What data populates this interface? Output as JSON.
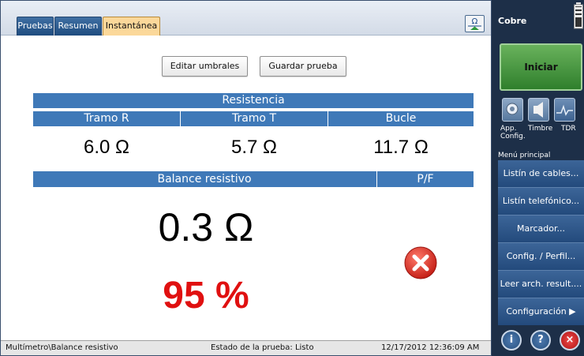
{
  "tabs": [
    {
      "label": "Pruebas",
      "active": false
    },
    {
      "label": "Resumen",
      "active": false
    },
    {
      "label": "Instantánea",
      "active": true
    }
  ],
  "toolbar": {
    "edit_thresholds": "Editar umbrales",
    "save_test": "Guardar prueba"
  },
  "resistance": {
    "title": "Resistencia",
    "columns": [
      "Tramo R",
      "Tramo T",
      "Bucle"
    ],
    "values": [
      "6.0 Ω",
      "5.7 Ω",
      "11.7 Ω"
    ]
  },
  "balance": {
    "title": "Balance resistivo",
    "pf_label": "P/F",
    "value": "0.3 Ω",
    "percent": "95 %",
    "result": "fail"
  },
  "status": {
    "path": "Multímetro\\Balance resistivo",
    "state": "Estado de la prueba: Listo",
    "datetime": "12/17/2012 12:36:09 AM"
  },
  "sidebar": {
    "title": "Cobre",
    "start_label": "Iniciar",
    "tools": [
      {
        "label": "App.\nConfig.",
        "icon": "wrench-icon"
      },
      {
        "label": "Timbre",
        "icon": "speaker-icon"
      },
      {
        "label": "TDR",
        "icon": "tdr-trace-icon"
      }
    ],
    "menu_title": "Menú principal",
    "menu_items": [
      "Listín de cables...",
      "Listín telefónico...",
      "Marcador...",
      "Config. / Perfil...",
      "Leer arch. result....",
      "Configuración ▶"
    ]
  },
  "colors": {
    "tab_blue": "#2f5f94",
    "tab_active": "#fbd89a",
    "header_blue": "#3f79b8",
    "percent_red": "#e01010",
    "sidebar_bg": "#1d2f48",
    "start_green": "#4a9a44"
  }
}
